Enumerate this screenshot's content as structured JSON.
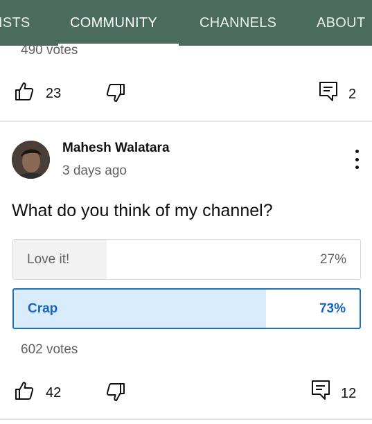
{
  "tabs": [
    {
      "label": "ISTS",
      "active": false
    },
    {
      "label": "COMMUNITY",
      "active": true
    },
    {
      "label": "CHANNELS",
      "active": false
    },
    {
      "label": "ABOUT",
      "active": false
    }
  ],
  "post1": {
    "votes": "490 votes",
    "likes": "23",
    "comments": "2"
  },
  "post2": {
    "author": "Mahesh Walatara",
    "time": "3 days ago",
    "question": "What do you think of my channel?",
    "options": [
      {
        "label": "Love it!",
        "percent": "27%",
        "fraction": 0.27
      },
      {
        "label": "Crap",
        "percent": "73%",
        "fraction": 0.73,
        "selected": true
      }
    ],
    "votes": "602 votes",
    "likes": "42",
    "comments": "12"
  },
  "icons": {
    "like": "thumb-up-icon",
    "dislike": "thumb-down-icon",
    "comment": "comment-icon",
    "menu": "more-vert-icon"
  },
  "colors": {
    "tab_bar": "#4a6b5d",
    "selected_accent": "#1565c0",
    "selected_fill": "#d9ecfb"
  }
}
